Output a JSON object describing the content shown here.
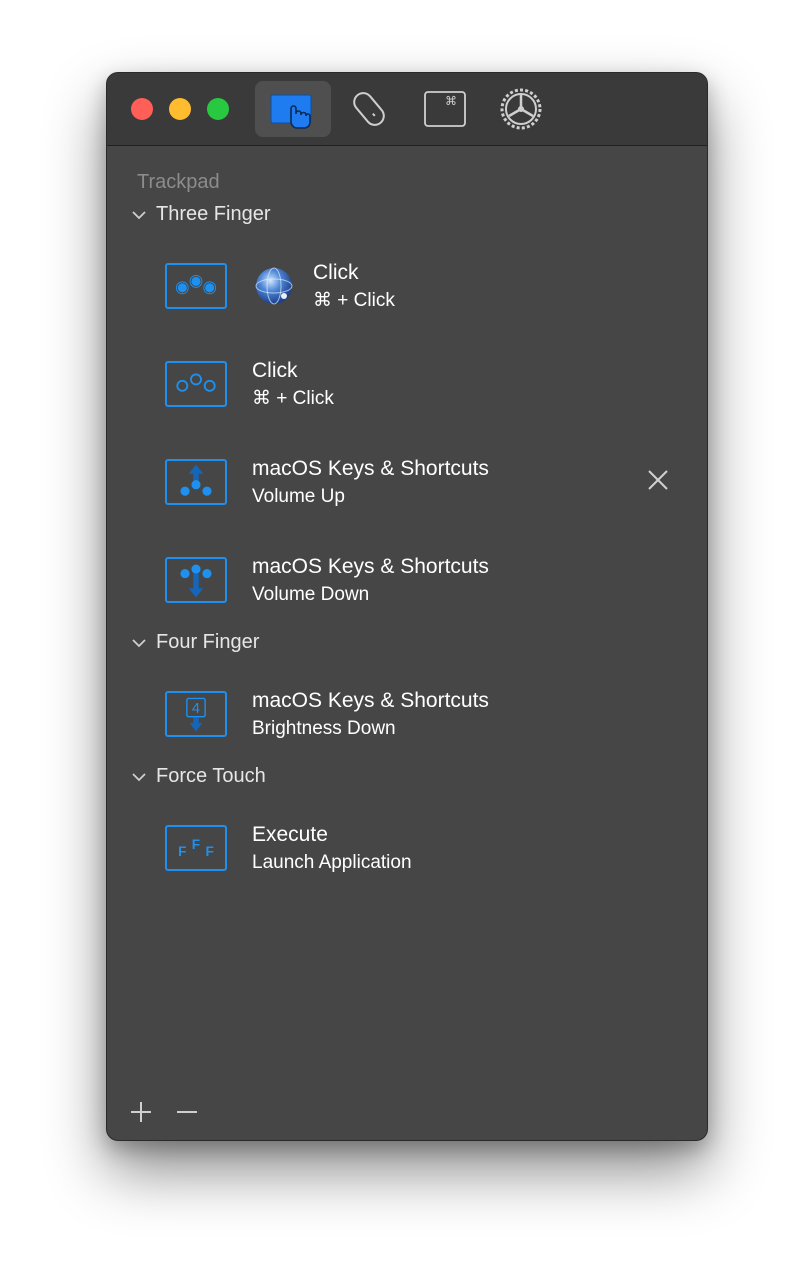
{
  "toolbar": {
    "tabs": [
      {
        "icon": "trackpad-icon",
        "selected": true
      },
      {
        "icon": "mouse-icon",
        "selected": false
      },
      {
        "icon": "keyboard-icon",
        "selected": false
      },
      {
        "icon": "settings-gear-icon",
        "selected": false
      }
    ],
    "keyboard_glyph": "⌘"
  },
  "section_title": "Trackpad",
  "groups": [
    {
      "label": "Three Finger",
      "items": [
        {
          "title": "Click",
          "subtitle": "⌘ + Click",
          "gesture": "three-finger-click",
          "app": "globe-app-icon"
        },
        {
          "title": "Click",
          "subtitle": "⌘ + Click",
          "gesture": "three-finger-click-outline"
        },
        {
          "title": "macOS Keys & Shortcuts",
          "subtitle": "Volume Up",
          "gesture": "three-finger-swipe-up",
          "removable": true
        },
        {
          "title": "macOS Keys & Shortcuts",
          "subtitle": "Volume Down",
          "gesture": "three-finger-swipe-down"
        }
      ]
    },
    {
      "label": "Four Finger",
      "items": [
        {
          "title": "macOS Keys & Shortcuts",
          "subtitle": "Brightness Down",
          "gesture": "four-finger-swipe-down",
          "gesture_label": "4"
        }
      ]
    },
    {
      "label": "Force Touch",
      "items": [
        {
          "title": "Execute",
          "subtitle": "Launch Application",
          "gesture": "force-touch",
          "gesture_label": "F"
        }
      ]
    }
  ],
  "colors": {
    "accent": "#1e90f0",
    "window_bg": "#464646",
    "titlebar_bg": "#3a3a3a"
  }
}
